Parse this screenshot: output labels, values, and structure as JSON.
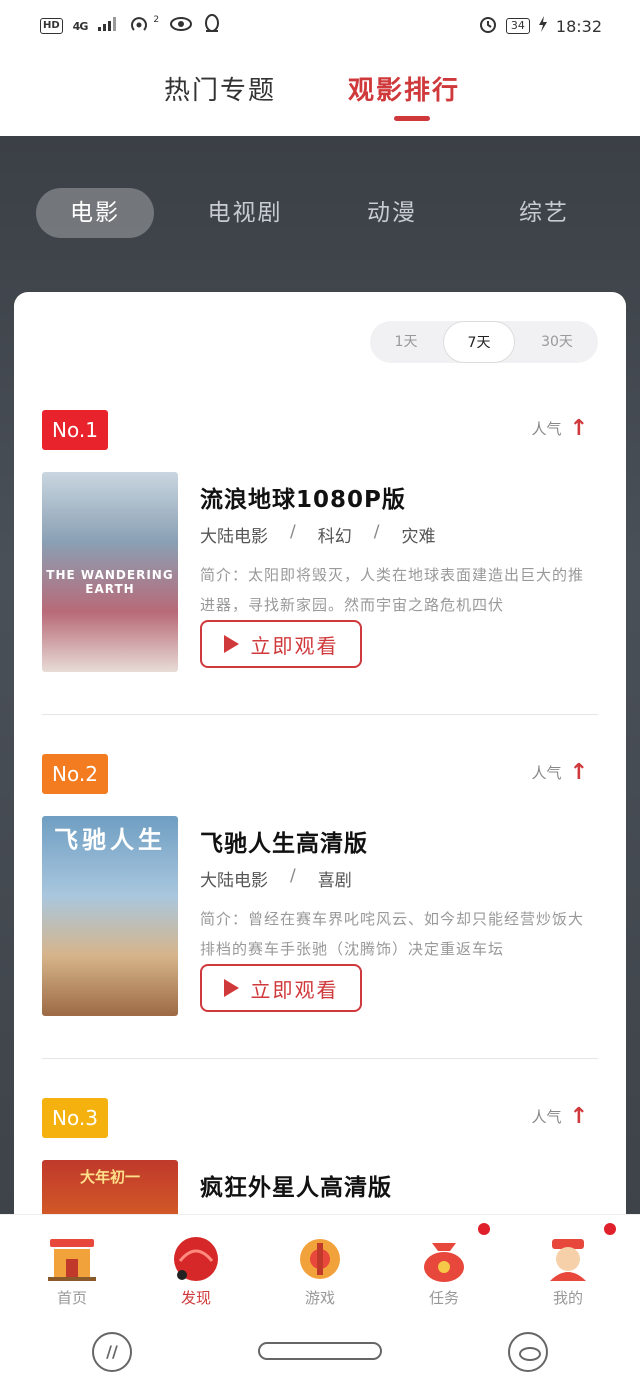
{
  "status_bar": {
    "hd": "HD",
    "network": "4G",
    "signal_sup": "2",
    "battery": "34",
    "time": "18:32",
    "icons": [
      "signal-icon",
      "hotspot-icon",
      "eye-icon",
      "qq-icon",
      "alarm-icon",
      "charging-icon"
    ]
  },
  "top_tabs": [
    {
      "label": "热门专题",
      "active": false
    },
    {
      "label": "观影排行",
      "active": true
    }
  ],
  "category_tabs": [
    {
      "label": "电影",
      "active": true
    },
    {
      "label": "电视剧",
      "active": false
    },
    {
      "label": "动漫",
      "active": false
    },
    {
      "label": "综艺",
      "active": false
    }
  ],
  "period_tabs": [
    {
      "label": "1天",
      "active": false
    },
    {
      "label": "7天",
      "active": true
    },
    {
      "label": "30天",
      "active": false
    }
  ],
  "rankings": [
    {
      "rank": "No.1",
      "badge_color": "#e8232b",
      "popularity_label": "人气",
      "title": "流浪地球1080P版",
      "tags": [
        "大陆电影",
        "科幻",
        "灾难"
      ],
      "description": "简介：太阳即将毁灭，人类在地球表面建造出巨大的推进器，寻找新家园。然而宇宙之路危机四伏",
      "poster_text": "THE WANDERING EARTH",
      "watch_label": "立即观看"
    },
    {
      "rank": "No.2",
      "badge_color": "#f47c20",
      "popularity_label": "人气",
      "title": "飞驰人生高清版",
      "tags": [
        "大陆电影",
        "喜剧"
      ],
      "description": "简介：曾经在赛车界叱咤风云、如今却只能经营炒饭大排档的赛车手张驰（沈腾饰）决定重返车坛",
      "poster_text": "飞驰人生",
      "watch_label": "立即观看"
    },
    {
      "rank": "No.3",
      "badge_color": "#f5b20f",
      "popularity_label": "人气",
      "title": "疯狂外星人高清版",
      "poster_text": "大年初一"
    }
  ],
  "separator": "/",
  "bottom_nav": [
    {
      "label": "首页",
      "active": false,
      "dot": false
    },
    {
      "label": "发现",
      "active": true,
      "dot": false
    },
    {
      "label": "游戏",
      "active": false,
      "dot": false
    },
    {
      "label": "任务",
      "active": false,
      "dot": true
    },
    {
      "label": "我的",
      "active": false,
      "dot": true
    }
  ],
  "colors": {
    "accent": "#d0393b",
    "hero": "#454a51"
  }
}
